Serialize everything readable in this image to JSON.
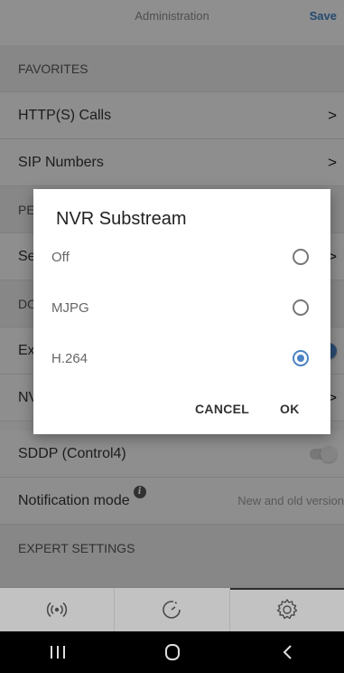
{
  "header": {
    "title": "Administration",
    "save_label": "Save"
  },
  "rows": {
    "favorites": "FAVORITES",
    "http_calls": "HTTP(S) Calls",
    "sip_numbers": "SIP Numbers",
    "section_pe": "PE",
    "row_se": "Se",
    "section_do": "DO",
    "row_ex": "Ex",
    "row_nv": "NV",
    "sddp": "SDDP (Control4)",
    "notification_mode": "Notification mode",
    "notification_value": "New and old version",
    "expert_settings": "EXPERT SETTINGS"
  },
  "dialog": {
    "title": "NVR Substream",
    "options": [
      {
        "label": "Off",
        "selected": false
      },
      {
        "label": "MJPG",
        "selected": false
      },
      {
        "label": "H.264",
        "selected": true
      }
    ],
    "cancel_label": "CANCEL",
    "ok_label": "OK"
  },
  "tabs": [
    {
      "icon": "broadcast-icon",
      "active": false
    },
    {
      "icon": "gauge-icon",
      "active": false
    },
    {
      "icon": "gear-icon",
      "active": true
    }
  ],
  "navbar": {
    "buttons": [
      "recent-apps-icon",
      "home-icon",
      "back-icon"
    ]
  },
  "colors": {
    "accent": "#4a83c4",
    "toggle_on": "#4a83c4",
    "overlay": "rgba(0,0,0,0.42)"
  },
  "info_glyph": "i",
  "chevron_glyph": ">"
}
